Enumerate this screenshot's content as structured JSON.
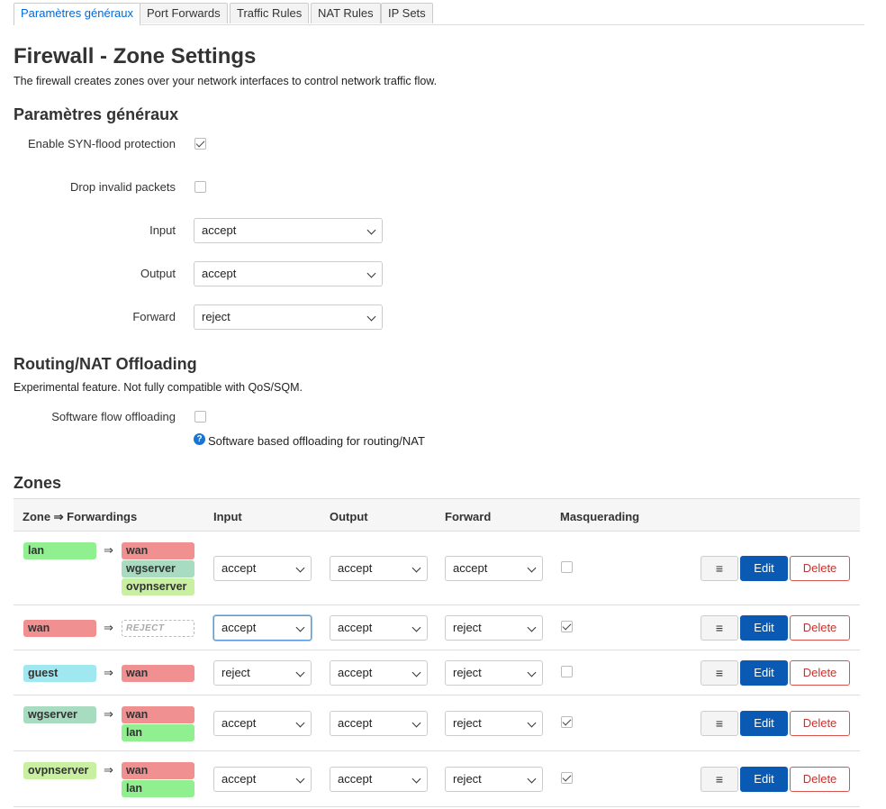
{
  "tabs": [
    {
      "label": "Paramètres généraux",
      "active": true
    },
    {
      "label": "Port Forwards"
    },
    {
      "label": "Traffic Rules"
    },
    {
      "label": "NAT Rules"
    },
    {
      "label": "IP Sets"
    }
  ],
  "page": {
    "title": "Firewall - Zone Settings",
    "description": "The firewall creates zones over your network interfaces to control network traffic flow."
  },
  "general": {
    "title": "Paramètres généraux",
    "syn_label": "Enable SYN-flood protection",
    "syn_checked": true,
    "drop_label": "Drop invalid packets",
    "drop_checked": false,
    "input_label": "Input",
    "input_value": "accept",
    "output_label": "Output",
    "output_value": "accept",
    "forward_label": "Forward",
    "forward_value": "reject"
  },
  "offload": {
    "title": "Routing/NAT Offloading",
    "description": "Experimental feature. Not fully compatible with QoS/SQM.",
    "sw_label": "Software flow offloading",
    "sw_checked": false,
    "help_glyph": "?",
    "help_text": "Software based offloading for routing/NAT"
  },
  "zones": {
    "title": "Zones",
    "headers": {
      "zone": "Zone ⇒ Forwardings",
      "input": "Input",
      "output": "Output",
      "forward": "Forward",
      "masq": "Masquerading"
    },
    "arrow": "⇒",
    "reject_label": "REJECT",
    "more_label": "≡",
    "edit_label": "Edit",
    "delete_label": "Delete",
    "colors": {
      "lan": "#90f090",
      "wan": "#f09090",
      "guest": "#a0e8f0",
      "wgserver": "#a8dcc0",
      "ovpnserver": "#c8f0a0"
    },
    "rows": [
      {
        "zone": "lan",
        "forwards": [
          "wan",
          "wgserver",
          "ovpnserver"
        ],
        "input": "accept",
        "output": "accept",
        "forward": "accept",
        "masq": false
      },
      {
        "zone": "wan",
        "forwards": [],
        "input": "accept",
        "output": "accept",
        "forward": "reject",
        "masq": true
      },
      {
        "zone": "guest",
        "forwards": [
          "wan"
        ],
        "input": "reject",
        "output": "accept",
        "forward": "reject",
        "masq": false
      },
      {
        "zone": "wgserver",
        "forwards": [
          "wan",
          "lan"
        ],
        "input": "accept",
        "output": "accept",
        "forward": "reject",
        "masq": true
      },
      {
        "zone": "ovpnserver",
        "forwards": [
          "wan",
          "lan"
        ],
        "input": "accept",
        "output": "accept",
        "forward": "reject",
        "masq": true
      }
    ]
  }
}
